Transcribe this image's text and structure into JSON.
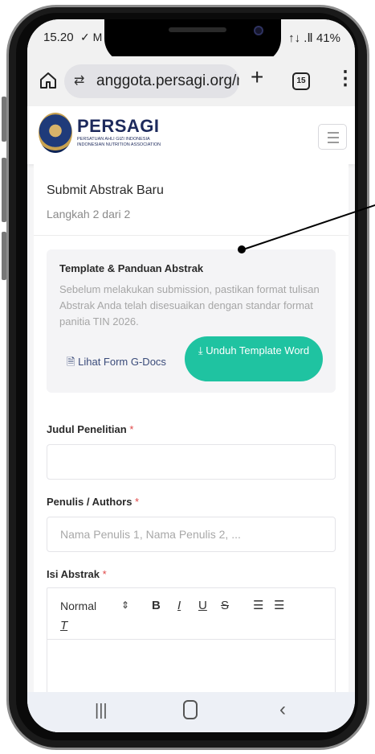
{
  "status_bar": {
    "time": "15.20",
    "left_icons": "✓ M",
    "right_text": "↑↓ .Ⅱ 41%"
  },
  "browser": {
    "url": "anggota.persagi.org/m",
    "tab_count": "15",
    "icons": [
      "home-icon",
      "site-settings-icon",
      "new-tab-icon",
      "tabs-icon",
      "more-menu-icon"
    ]
  },
  "site_header": {
    "brand": "PERSAGI",
    "subtitle_line1": "PERSATUAN AHLI GIZI INDONESIA",
    "subtitle_line2": "INDONESIAN NUTRITION ASSOCIATION"
  },
  "form": {
    "title": "Submit Abstrak Baru",
    "step": "Langkah 2 dari 2",
    "template_box": {
      "title": "Template & Panduan Abstrak",
      "description": "Sebelum melakukan submission, pastikan format tulisan Abstrak Anda telah disesuaikan dengan standar format panitia TIN 2026.",
      "gdocs_link": "Lihat Form G-Docs",
      "download_button": "Unduh Template Word"
    },
    "fields": {
      "judul_label": "Judul Penelitian",
      "judul_value": "",
      "authors_label": "Penulis / Authors",
      "authors_placeholder": "Nama Penulis 1, Nama Penulis 2, ...",
      "abstrak_label": "Isi Abstrak",
      "required_mark": "*"
    },
    "editor_toolbar": {
      "format_select": "Normal",
      "bold": "B",
      "italic": "I",
      "underline": "U",
      "strike": "S",
      "icons": [
        "ordered-list-icon",
        "bullet-list-icon",
        "clear-format-icon"
      ]
    }
  },
  "colors": {
    "accent": "#1fc3a1",
    "brand_navy": "#1d2a5c",
    "required": "#e04848",
    "link": "#3a4b7a"
  }
}
